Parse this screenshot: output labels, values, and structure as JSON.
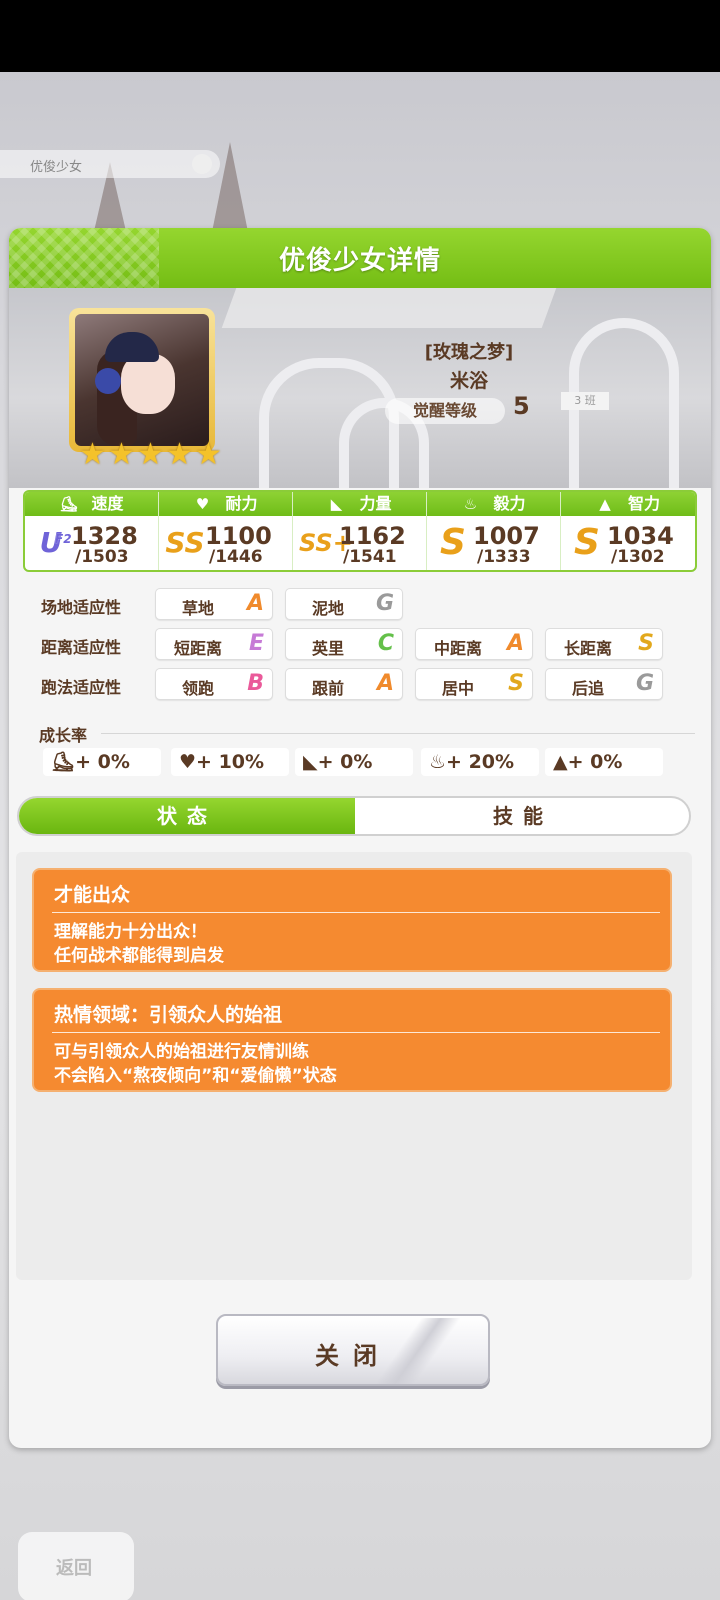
{
  "background": {
    "top_chip_text": "优俊少女",
    "back_button_label": "返回"
  },
  "dialog": {
    "title": "优俊少女详情"
  },
  "character": {
    "epithet": "[玫瑰之梦]",
    "name": "米浴",
    "awakening_label": "觉醒等级",
    "awakening_level": "5",
    "stars": 5
  },
  "stats": [
    {
      "label": "速度",
      "icon": "shoe-icon",
      "glyph": "⛸",
      "grade": "U",
      "grade_sup": "F2",
      "value": "1328",
      "max": "/1503"
    },
    {
      "label": "耐力",
      "icon": "heart-icon",
      "glyph": "♥",
      "grade": "SS",
      "grade_sup": "",
      "value": "1100",
      "max": "/1446"
    },
    {
      "label": "力量",
      "icon": "muscle-icon",
      "glyph": "◣",
      "grade": "SS+",
      "grade_sup": "",
      "value": "1162",
      "max": "/1541"
    },
    {
      "label": "毅力",
      "icon": "flame-icon",
      "glyph": "♨",
      "grade": "S",
      "grade_sup": "",
      "value": "1007",
      "max": "/1333"
    },
    {
      "label": "智力",
      "icon": "graduation-cap-icon",
      "glyph": "▲",
      "grade": "S",
      "grade_sup": "",
      "value": "1034",
      "max": "/1302"
    }
  ],
  "aptitude": {
    "track": {
      "label": "场地适应性",
      "cells": [
        {
          "name": "草地",
          "grade": "A"
        },
        {
          "name": "泥地",
          "grade": "G"
        }
      ]
    },
    "distance": {
      "label": "距离适应性",
      "cells": [
        {
          "name": "短距离",
          "grade": "E"
        },
        {
          "name": "英里",
          "grade": "C"
        },
        {
          "name": "中距离",
          "grade": "A"
        },
        {
          "name": "长距离",
          "grade": "S"
        }
      ]
    },
    "strategy": {
      "label": "跑法适应性",
      "cells": [
        {
          "name": "领跑",
          "grade": "B"
        },
        {
          "name": "跟前",
          "grade": "A"
        },
        {
          "name": "居中",
          "grade": "S"
        },
        {
          "name": "后追",
          "grade": "G"
        }
      ]
    }
  },
  "growth": {
    "label": "成长率",
    "values": [
      "+ 0%",
      "+ 10%",
      "+ 0%",
      "+ 20%",
      "+ 0%"
    ]
  },
  "tabs": {
    "status": "状态",
    "skills": "技能"
  },
  "status_cards": [
    {
      "title": "才能出众",
      "lines": [
        "理解能力十分出众！",
        "任何战术都能得到启发"
      ]
    },
    {
      "title": "热情领域：引领众人的始祖",
      "lines": [
        "可与引领众人的始祖进行友情训练",
        "不会陷入“熬夜倾向”和“爱偷懒”状态"
      ]
    }
  ],
  "close_button": "关闭",
  "colors": {
    "header_green": "#74bd14",
    "card_orange": "#f58a30",
    "text_brown": "#5a3a24"
  }
}
